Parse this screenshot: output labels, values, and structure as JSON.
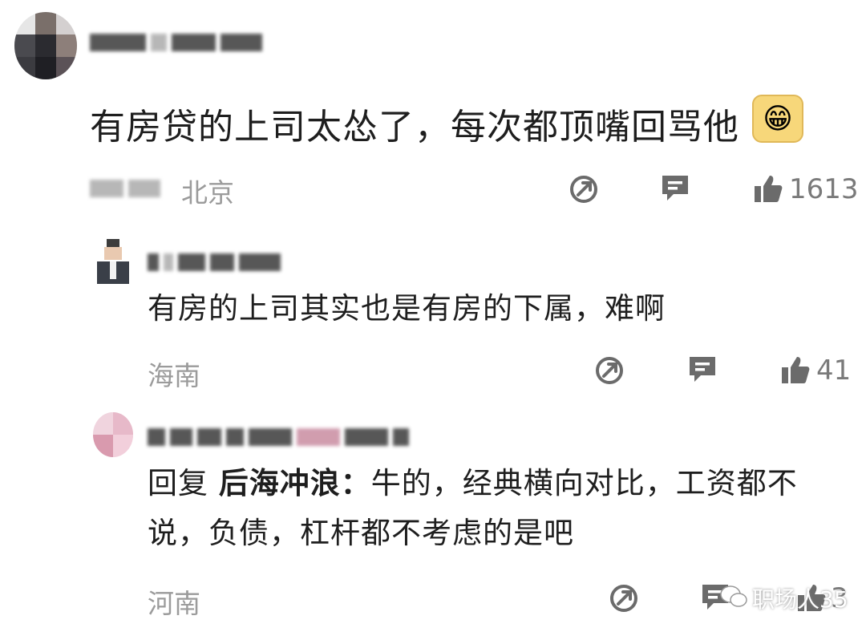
{
  "comment": {
    "text": "有房贷的上司太怂了，每次都顶嘴回骂他",
    "emoji": "😁",
    "location": "北京",
    "likes": "1613"
  },
  "reply1": {
    "text": "有房的上司其实也是有房的下属，难啊",
    "location": "海南",
    "likes": "41"
  },
  "reply2": {
    "prefix": "回复 ",
    "target": "后海冲浪：",
    "text_line1": "牛的，经典横向对比，工资都不",
    "text_line2": "说，负债，杠杆都不考虑的是吧",
    "location": "河南",
    "likes": "3"
  },
  "watermark": "职场人35",
  "colors": {
    "text": "#1e1e1e",
    "meta": "#9b9b9b",
    "icon": "#6b6b6b"
  },
  "icons": [
    "share-icon",
    "comment-icon",
    "like-icon",
    "wechat-icon"
  ]
}
